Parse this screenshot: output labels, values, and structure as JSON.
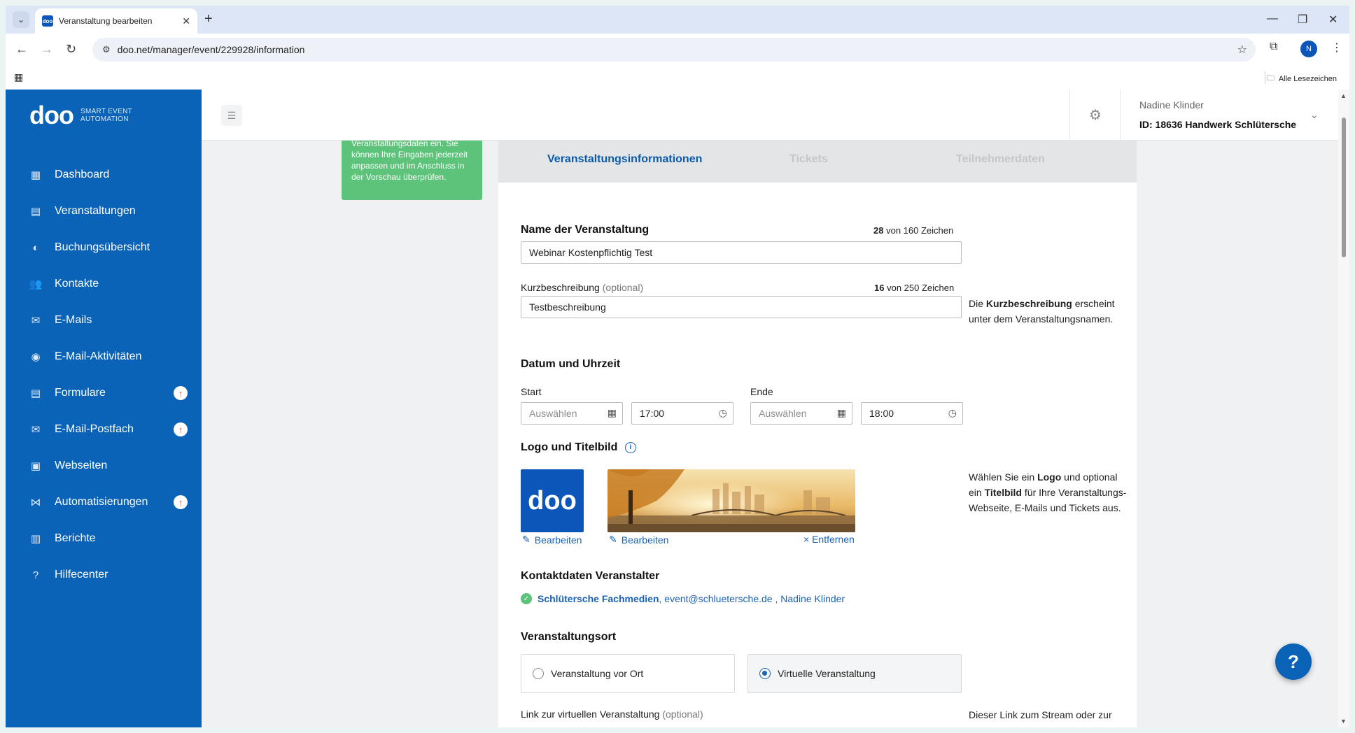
{
  "browser": {
    "tab_title": "Veranstaltung bearbeiten",
    "favicon_text": "doo",
    "url": "doo.net/manager/event/229928/information",
    "profile_initial": "N",
    "bookmarks_label": "Alle Lesezeichen"
  },
  "app": {
    "logo_word": "doo",
    "logo_tag_line1": "SMART EVENT",
    "logo_tag_line2": "AUTOMATION",
    "accent_color": "#0a63b7",
    "sidebar": {
      "items": [
        {
          "label": "Dashboard",
          "icon": "dashboard-icon"
        },
        {
          "label": "Veranstaltungen",
          "icon": "calendar-icon"
        },
        {
          "label": "Buchungsübersicht",
          "icon": "bookings-icon"
        },
        {
          "label": "Kontakte",
          "icon": "contacts-icon"
        },
        {
          "label": "E-Mails",
          "icon": "mail-icon"
        },
        {
          "label": "E-Mail-Aktivitäten",
          "icon": "activity-icon"
        },
        {
          "label": "Formulare",
          "icon": "forms-icon",
          "badge": "↑"
        },
        {
          "label": "E-Mail-Postfach",
          "icon": "inbox-icon",
          "badge": "↑"
        },
        {
          "label": "Webseiten",
          "icon": "website-icon"
        },
        {
          "label": "Automatisierungen",
          "icon": "automation-icon",
          "badge": "↑"
        },
        {
          "label": "Berichte",
          "icon": "reports-icon"
        },
        {
          "label": "Hilfecenter",
          "icon": "help-icon"
        }
      ]
    },
    "header": {
      "user_name": "Nadine Klinder",
      "user_id": "ID: 18636  Handwerk Schlütersche"
    }
  },
  "hint": {
    "text": "Veranstaltungsdaten ein. Sie können Ihre Eingaben jederzeit anpassen und im Anschluss in der Vorschau überprüfen."
  },
  "steps": [
    {
      "label": "Veranstaltungsinformationen",
      "active": true
    },
    {
      "label": "Tickets",
      "active": false
    },
    {
      "label": "Teilnehmerdaten",
      "active": false
    }
  ],
  "form": {
    "name_label": "Name der Veranstaltung",
    "name_count": "28",
    "name_count_suffix": "von 160 Zeichen",
    "name_value": "Webinar Kostenpflichtig Test",
    "short_label": "Kurzbeschreibung",
    "short_optional": "(optional)",
    "short_count": "16",
    "short_count_suffix": "von 250 Zeichen",
    "short_value": "Testbeschreibung",
    "short_note_pre": "Die ",
    "short_note_bold": "Kurzbeschreibung",
    "short_note_post": " erscheint unter dem Veranstaltungsnamen.",
    "datetime_heading": "Datum und Uhrzeit",
    "start_label": "Start",
    "end_label": "Ende",
    "start_date_placeholder": "Auswählen",
    "start_time": "17:00",
    "end_date_placeholder": "Auswählen",
    "end_time": "18:00",
    "images_heading": "Logo und Titelbild",
    "logo_text": "doo",
    "edit_label": "Bearbeiten",
    "remove_label": "× Entfernen",
    "images_note_1": "Wählen Sie ein ",
    "images_note_logo": "Logo",
    "images_note_2": " und optional ein ",
    "images_note_title": "Titelbild",
    "images_note_3": " für Ihre Veranstaltungs-Webseite, E-Mails und Tickets aus.",
    "contact_heading": "Kontaktdaten Veranstalter",
    "contact_org": "Schlütersche Fachmedien",
    "contact_rest": ", event@schluetersche.de , Nadine Klinder",
    "location_heading": "Veranstaltungsort",
    "location_onsite": "Veranstaltung vor Ort",
    "location_virtual": "Virtuelle Veranstaltung",
    "location_selected": "virtual",
    "link_label": "Link zur virtuellen Veranstaltung",
    "link_optional": "(optional)",
    "link_note": "Dieser Link zum Stream oder zur"
  },
  "help_button": "?"
}
